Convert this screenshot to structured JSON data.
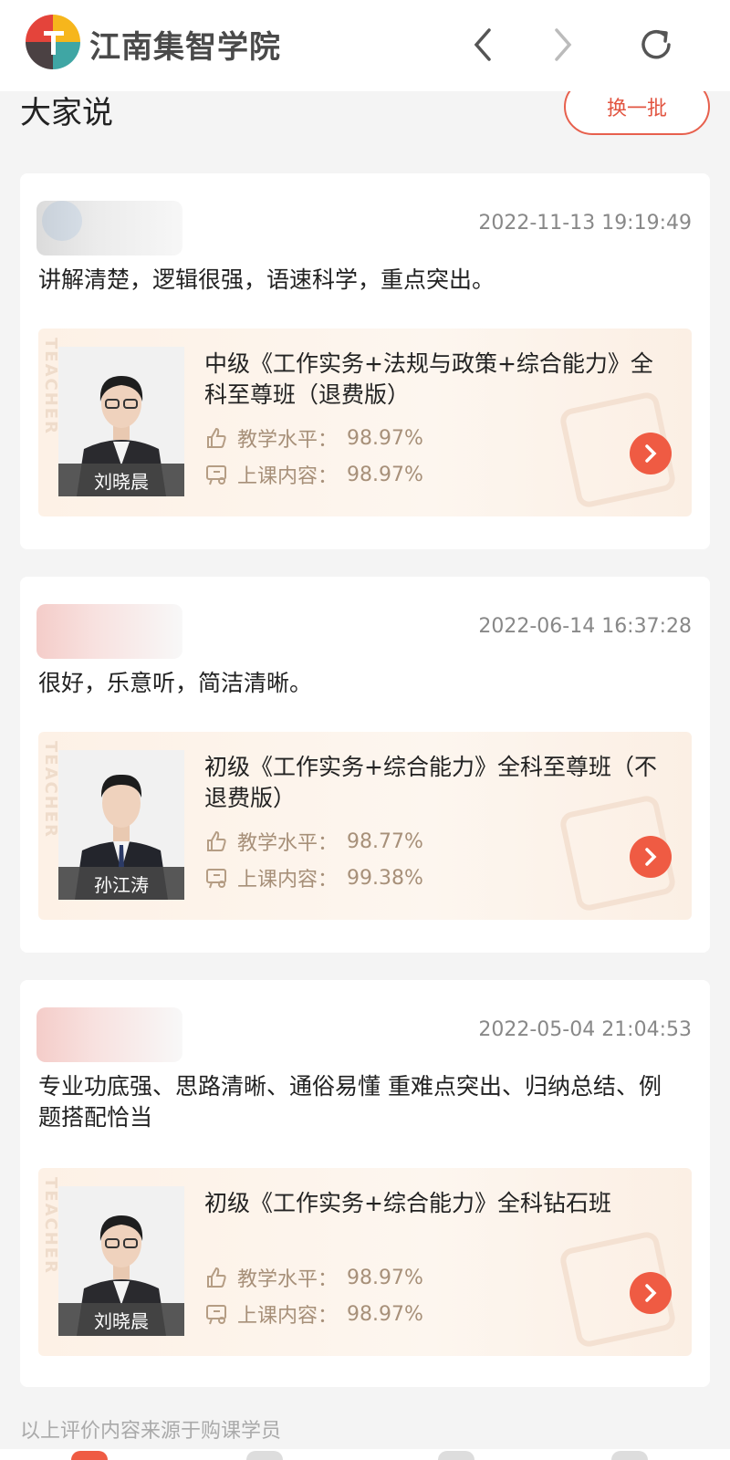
{
  "header": {
    "brand_name": "江南集智学院",
    "icons": [
      "back-icon",
      "forward-icon",
      "refresh-icon"
    ],
    "colors": {
      "logo_red": "#e4443b",
      "logo_yellow": "#f6b61c",
      "logo_teal": "#3fa6a4",
      "logo_dark": "#4b4143"
    }
  },
  "section": {
    "title": "大家说",
    "refresh_button": "换一批"
  },
  "reviews": [
    {
      "time": "2022-11-13 19:19:49",
      "comment": "讲解清楚，逻辑很强，语速科学，重点突出。",
      "course_title": "中级《工作实务+法规与政策+综合能力》全科至尊班（退费版）",
      "teacher": "刘晓晨",
      "teaching_level_label": "教学水平：",
      "teaching_level": "98.97%",
      "content_label": "上课内容：",
      "content_score": "98.97%"
    },
    {
      "time": "2022-06-14 16:37:28",
      "comment": "很好，乐意听，简洁清晰。",
      "course_title": "初级《工作实务+综合能力》全科至尊班（不退费版）",
      "teacher": "孙江涛",
      "teaching_level_label": "教学水平：",
      "teaching_level": "98.77%",
      "content_label": "上课内容：",
      "content_score": "99.38%"
    },
    {
      "time": "2022-05-04 21:04:53",
      "comment": "专业功底强、思路清晰、通俗易懂 重难点突出、归纳总结、例题搭配恰当",
      "course_title": "初级《工作实务+综合能力》全科钻石班",
      "teacher": "刘晓晨",
      "teaching_level_label": "教学水平：",
      "teaching_level": "98.97%",
      "content_label": "上课内容：",
      "content_score": "98.97%"
    }
  ],
  "watermark": "TEACHER",
  "footer_note": "以上评价内容来源于购课学员",
  "accent_color": "#ef5b43"
}
